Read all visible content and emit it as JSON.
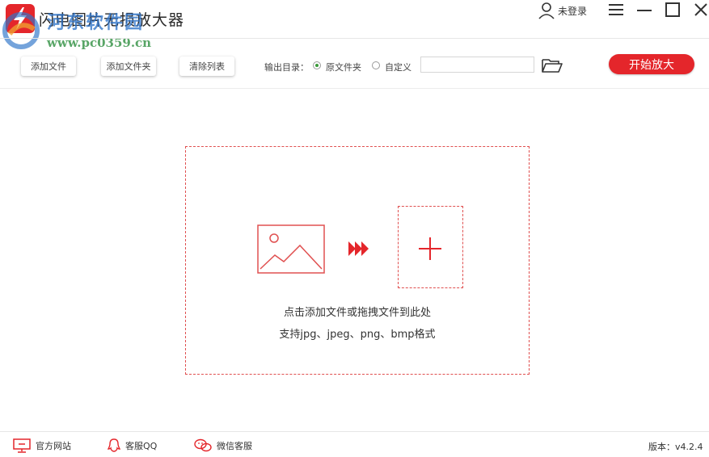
{
  "app": {
    "title": "闪电图片无损放大器",
    "watermark_line1": "河东软件园",
    "watermark_line2": "www.pc0359.cn"
  },
  "titlebar": {
    "login_label": "未登录",
    "icons": [
      "user-icon",
      "menu-icon",
      "minimize-icon",
      "maximize-icon",
      "close-icon"
    ]
  },
  "toolbar": {
    "add_file": "添加文件",
    "add_folder": "添加文件夹",
    "clear_list": "清除列表",
    "output_label": "输出目录：",
    "radio_original": "原文件夹",
    "radio_custom": "自定义",
    "selected_output": "原文件夹",
    "path_value": "",
    "path_placeholder": "",
    "start_button": "开始放大"
  },
  "dropzone": {
    "hint_line1": "点击添加文件或拖拽文件到此处",
    "hint_line2": "支持jpg、jpeg、png、bmp格式"
  },
  "footer": {
    "website": "官方网站",
    "qq": "客服QQ",
    "wechat": "微信客服",
    "version": "版本：v4.2.4"
  },
  "colors": {
    "accent_red": "#e4262b",
    "dashed_border": "#e05050",
    "radio_selected": "#3a9a3a"
  }
}
